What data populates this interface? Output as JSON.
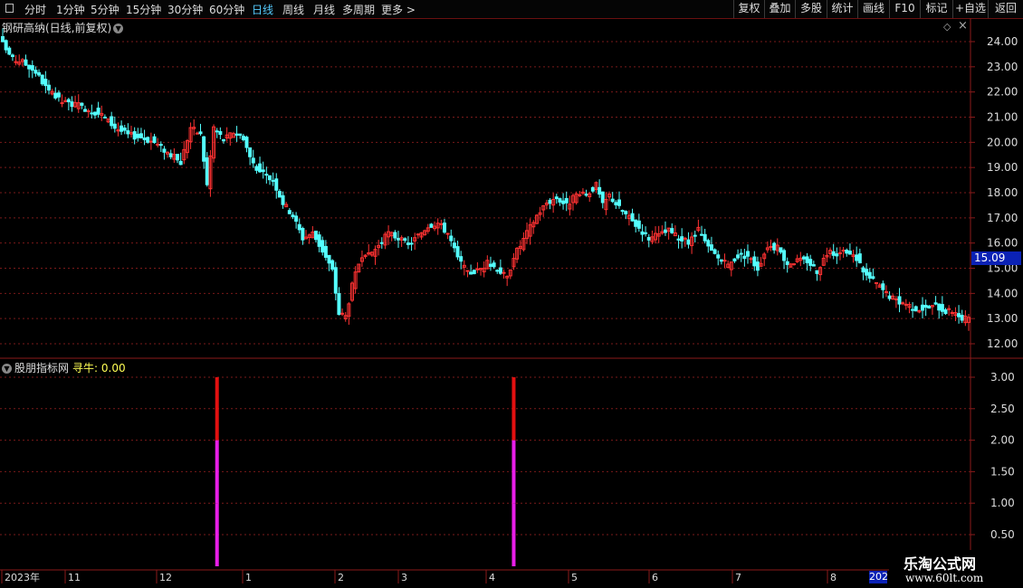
{
  "toolbar": {
    "periods": [
      "分时",
      "1分钟",
      "5分钟",
      "15分钟",
      "30分钟",
      "60分钟",
      "日线",
      "周线",
      "月线",
      "多周期",
      "更多 >"
    ],
    "active_period": "日线",
    "right_buttons": [
      "复权",
      "叠加",
      "多股",
      "统计",
      "画线",
      "F10",
      "标记",
      "+自选",
      "返回"
    ]
  },
  "main_panel": {
    "title": "钢研高纳(日线,前复权)",
    "current_price": "15.09",
    "colors": {
      "up": "#ff3232",
      "down": "#54ffff",
      "grid": "#7a1a1a",
      "axis": "#8b1a1a"
    }
  },
  "indicator_panel": {
    "title": "股朋指标网",
    "indicator_name": "寻牛:",
    "indicator_value": "0.00"
  },
  "logo": {
    "line1": "乐淘公式网",
    "line2": "www.60lt.com"
  },
  "year_end_label": "202",
  "chart_data": [
    {
      "type": "candlestick",
      "title": "钢研高纳(日线,前复权)",
      "ylim": [
        12.0,
        24.4
      ],
      "yticks": [
        "24.00",
        "23.00",
        "22.00",
        "21.00",
        "20.00",
        "19.00",
        "18.00",
        "17.00",
        "16.00",
        "15.00",
        "14.00",
        "13.00",
        "12.00"
      ],
      "xticks": [
        "2023年",
        "11",
        "12",
        "1",
        "2",
        "3",
        "4",
        "5",
        "6",
        "7",
        "8"
      ],
      "grid": true,
      "close_path": [
        [
          0,
          23.9
        ],
        [
          3,
          23.3
        ],
        [
          6,
          23.2
        ],
        [
          10,
          22.8
        ],
        [
          14,
          22.0
        ],
        [
          18,
          21.6
        ],
        [
          22,
          21.5
        ],
        [
          26,
          21.3
        ],
        [
          30,
          21.1
        ],
        [
          34,
          20.6
        ],
        [
          38,
          20.3
        ],
        [
          42,
          20.2
        ],
        [
          46,
          20.0
        ],
        [
          50,
          19.6
        ],
        [
          54,
          19.2
        ],
        [
          57,
          20.6
        ],
        [
          60,
          20.3
        ],
        [
          62,
          18.3
        ],
        [
          64,
          20.6
        ],
        [
          67,
          20.1
        ],
        [
          70,
          20.4
        ],
        [
          73,
          20.2
        ],
        [
          75,
          19.4
        ],
        [
          78,
          18.8
        ],
        [
          82,
          18.5
        ],
        [
          85,
          17.6
        ],
        [
          88,
          17.1
        ],
        [
          91,
          16.2
        ],
        [
          94,
          16.4
        ],
        [
          97,
          15.7
        ],
        [
          100,
          14.9
        ],
        [
          102,
          13.2
        ],
        [
          104,
          13.1
        ],
        [
          106,
          14.3
        ],
        [
          108,
          15.2
        ],
        [
          111,
          15.5
        ],
        [
          114,
          15.9
        ],
        [
          117,
          16.4
        ],
        [
          120,
          16.2
        ],
        [
          123,
          15.9
        ],
        [
          126,
          16.3
        ],
        [
          129,
          16.7
        ],
        [
          132,
          16.8
        ],
        [
          135,
          16.4
        ],
        [
          138,
          15.4
        ],
        [
          141,
          14.8
        ],
        [
          144,
          14.9
        ],
        [
          147,
          15.2
        ],
        [
          150,
          15.0
        ],
        [
          153,
          14.6
        ],
        [
          155,
          15.5
        ],
        [
          157,
          15.9
        ],
        [
          159,
          16.4
        ],
        [
          162,
          17.1
        ],
        [
          165,
          17.6
        ],
        [
          168,
          17.8
        ],
        [
          171,
          17.5
        ],
        [
          174,
          17.9
        ],
        [
          177,
          17.9
        ],
        [
          180,
          18.3
        ],
        [
          182,
          17.5
        ],
        [
          184,
          17.9
        ],
        [
          187,
          17.4
        ],
        [
          190,
          17.0
        ],
        [
          193,
          16.6
        ],
        [
          196,
          16.2
        ],
        [
          199,
          16.3
        ],
        [
          202,
          16.5
        ],
        [
          205,
          16.2
        ],
        [
          208,
          16.0
        ],
        [
          211,
          16.5
        ],
        [
          214,
          15.8
        ],
        [
          217,
          15.4
        ],
        [
          220,
          15.1
        ],
        [
          223,
          15.5
        ],
        [
          226,
          15.5
        ],
        [
          229,
          15.0
        ],
        [
          232,
          15.9
        ],
        [
          235,
          15.8
        ],
        [
          238,
          15.2
        ],
        [
          241,
          15.3
        ],
        [
          244,
          15.3
        ],
        [
          247,
          14.9
        ],
        [
          250,
          15.6
        ],
        [
          253,
          15.6
        ],
        [
          256,
          15.6
        ],
        [
          259,
          15.4
        ],
        [
          262,
          14.7
        ],
        [
          265,
          14.4
        ],
        [
          268,
          14.0
        ],
        [
          271,
          13.7
        ],
        [
          274,
          13.6
        ],
        [
          277,
          13.4
        ],
        [
          280,
          13.4
        ],
        [
          283,
          13.5
        ],
        [
          286,
          13.3
        ],
        [
          289,
          13.3
        ],
        [
          291,
          12.9
        ],
        [
          293,
          13.1
        ]
      ],
      "current_price": 15.09
    },
    {
      "type": "bar",
      "title": "股朋指标网",
      "series": [
        {
          "name": "寻牛",
          "values": [
            3.0,
            3.0
          ]
        }
      ],
      "x_positions": [
        65,
        155
      ],
      "segments": [
        [
          0,
          1,
          "#e81ee8"
        ],
        [
          1,
          2,
          "#e81ee8"
        ],
        [
          2,
          3,
          "#e21010"
        ]
      ],
      "ylim": [
        0.0,
        3.2
      ],
      "yticks": [
        "3.00",
        "2.50",
        "2.00",
        "1.50",
        "1.00",
        "0.50"
      ],
      "grid": true
    }
  ]
}
